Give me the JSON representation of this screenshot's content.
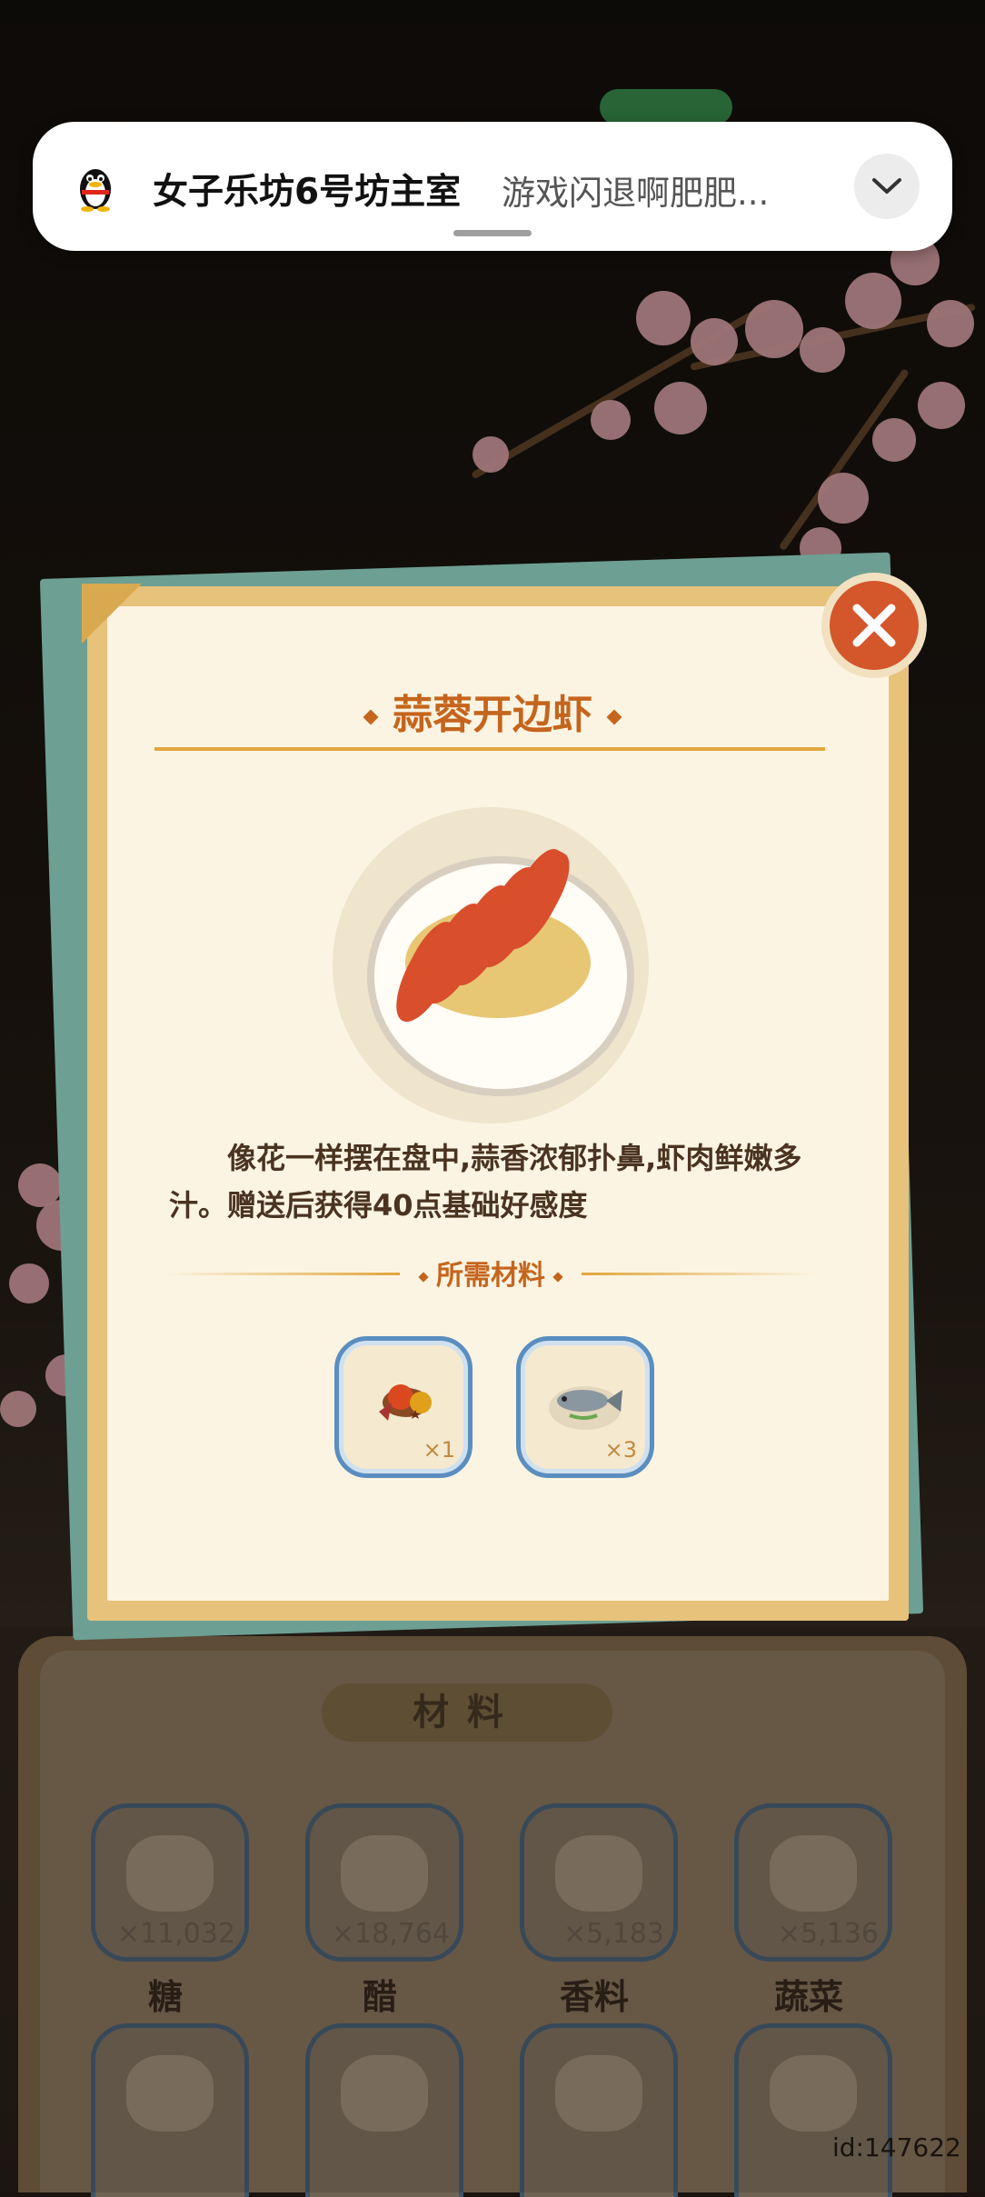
{
  "notification": {
    "title": "女子乐坊6号坊主室",
    "message": "游戏闪退啊肥肥..."
  },
  "dialog": {
    "dish_name": "蒜蓉开边虾",
    "description": "像花一样摆在盘中,蒜香浓郁扑鼻,虾肉鲜嫩多汁。赠送后获得40点基础好感度",
    "required_label": "所需材料",
    "ingredients": [
      {
        "name": "spice-mix",
        "qty": "×1"
      },
      {
        "name": "fish",
        "qty": "×3"
      }
    ]
  },
  "materials_panel": {
    "title": "材料",
    "items": [
      {
        "name": "糖",
        "qty": "×11,032"
      },
      {
        "name": "醋",
        "qty": "×18,764"
      },
      {
        "name": "香料",
        "qty": "×5,183"
      },
      {
        "name": "蔬菜",
        "qty": "×5,136"
      }
    ]
  },
  "user_id": "id:147622",
  "colors": {
    "accent": "#c5651d",
    "close": "#d4562b",
    "frame": "#5a8ec0",
    "paper": "#fbf4e2"
  }
}
